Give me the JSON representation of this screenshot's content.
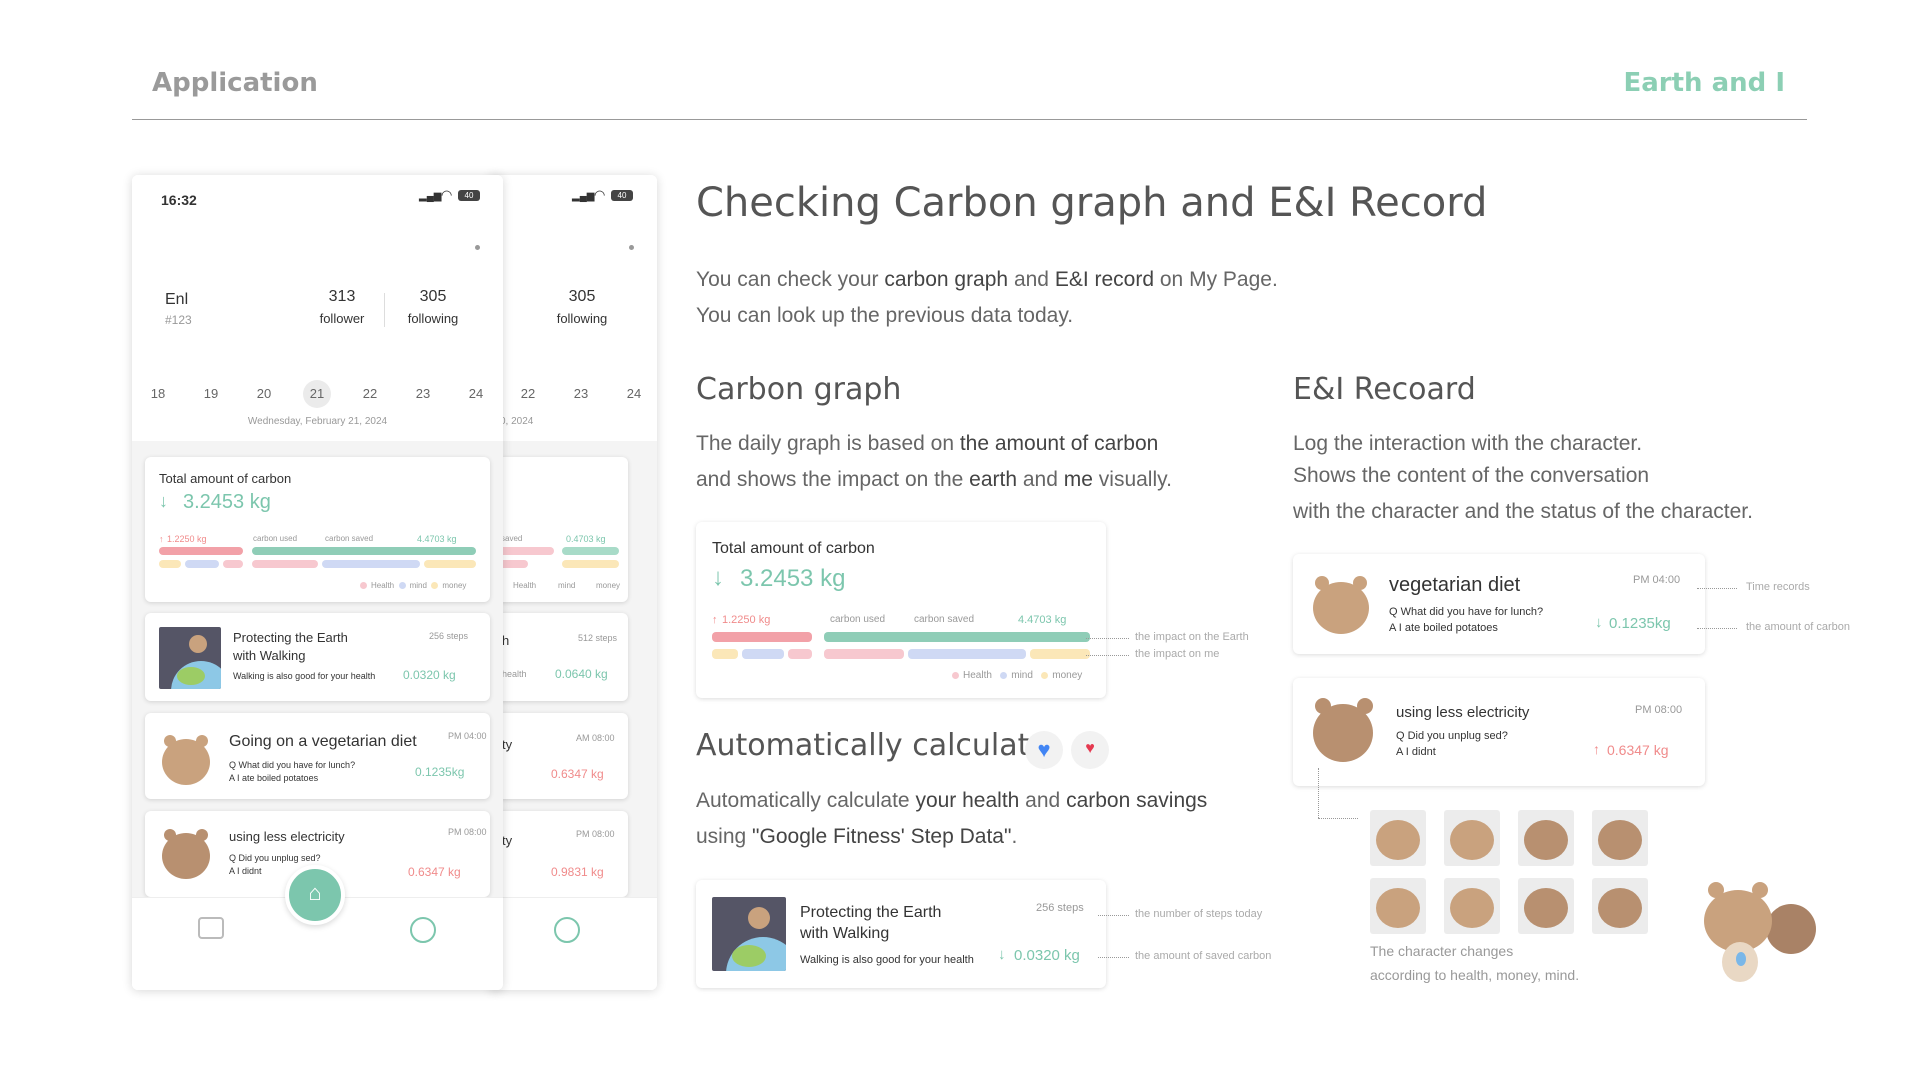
{
  "header": {
    "left": "Application",
    "right": "Earth and I"
  },
  "phone": {
    "status_time": "16:32",
    "battery": "40",
    "profile": {
      "name": "Enl",
      "id": "#123",
      "follower_count": "313",
      "follower_label": "follower",
      "following_count": "305",
      "following_label": "following"
    },
    "days": [
      "18",
      "19",
      "20",
      "21",
      "22",
      "23",
      "24"
    ],
    "selected_date": "Wednesday, February 21, 2024",
    "carbon_card": {
      "title": "Total amount of carbon",
      "value": "3.2453 kg",
      "used": "1.2250 kg",
      "used_label": "carbon used",
      "saved_label": "carbon saved",
      "saved": "4.4703 kg",
      "legend": [
        "Health",
        "mind",
        "money"
      ]
    },
    "walk_card": {
      "title": "Protecting the Earth with Walking",
      "sub": "Walking is also good for your health",
      "steps": "256 steps",
      "amount": "0.0320 kg"
    },
    "veg_card": {
      "title": "Going on a vegetarian diet",
      "time": "PM 04:00",
      "q": "Q What did you have for lunch?",
      "a": "A I ate boiled potatoes",
      "amount": "0.1235kg"
    },
    "elec_card": {
      "title": "using less electricity",
      "time": "PM 08:00",
      "q": "Q Did you unplug sed?",
      "a": "A I didnt",
      "amount": "0.6347 kg"
    }
  },
  "back_phone": {
    "following_count": "305",
    "following_label": "following",
    "follower_frag": "er",
    "days": [
      "22",
      "23",
      "24"
    ],
    "date_frag": "0, 2024",
    "carbon_saved_label": "saved",
    "carbon_saved": "0.4703 kg",
    "legend": [
      "Health",
      "mind",
      "money"
    ],
    "walk_frag": "h",
    "walk_sub_frag": "health",
    "walk_steps": "512 steps",
    "walk_amount": "0.0640 kg",
    "c3_frag": "ty",
    "c3_time": "AM 08:00",
    "c3_amount": "0.6347 kg",
    "c4_frag": "ty",
    "c4_time": "PM 08:00",
    "c4_amount": "0.9831 kg"
  },
  "main": {
    "title": "Checking Carbon graph and E&I Record",
    "intro1_a": "You can check your ",
    "intro1_b": "carbon graph",
    "intro1_c": " and ",
    "intro1_d": "E&I record",
    "intro1_e": " on My Page.",
    "intro2": "You can look up the previous data today."
  },
  "carbon_section": {
    "title": "Carbon graph",
    "l1_a": "The daily graph is based on ",
    "l1_b": "the amount of carbon",
    "l2_a": "and shows the impact on the ",
    "l2_b": "earth",
    "l2_c": " and ",
    "l2_d": "me",
    "l2_e": " visually.",
    "card": {
      "title": "Total amount of carbon",
      "value": "3.2453 kg",
      "used": "1.2250 kg",
      "used_label": "carbon used",
      "saved_label": "carbon saved",
      "saved": "4.4703 kg",
      "legend": [
        "Health",
        "mind",
        "money"
      ]
    },
    "ann_earth": "the impact on the Earth",
    "ann_me": "the impact on me"
  },
  "auto_section": {
    "title": "Automatically calculate",
    "l1_a": "Automatically calculate ",
    "l1_b": "your health",
    "l1_c": " and ",
    "l1_d": "carbon savings",
    "l2_a": "using ",
    "l2_b": "\"Google Fitness' Step Data\"",
    "l2_c": ".",
    "card": {
      "title": "Protecting the Earth with Walking",
      "sub": "Walking is also good for your health",
      "steps": "256 steps",
      "amount": "0.0320 kg"
    },
    "ann_steps": "the number of steps today",
    "ann_saved": "the amount of saved carbon"
  },
  "record_section": {
    "title": "E&I Recoard",
    "l1": "Log the interaction with the character.",
    "l2": "Shows the content of the conversation",
    "l3": "with the character and the status of the character.",
    "veg": {
      "title": "vegetarian diet",
      "time": "PM 04:00",
      "q": "Q What did you have for lunch?",
      "a": "A I ate boiled potatoes",
      "amount": "0.1235kg"
    },
    "elec": {
      "title": "using less electricity",
      "time": "PM 08:00",
      "q": "Q Did you unplug sed?",
      "a": "A I didnt",
      "amount": "0.6347 kg"
    },
    "ann_time": "Time records",
    "ann_amount": "the amount of carbon",
    "caption1": "The character changes",
    "caption2": "according to health, money, mind."
  },
  "colors": {
    "accent": "#7cc6ad",
    "red": "#f08b8b",
    "pink": "#f7c8cf",
    "blue": "#cfd9f4",
    "yellow": "#fbe7b8"
  }
}
